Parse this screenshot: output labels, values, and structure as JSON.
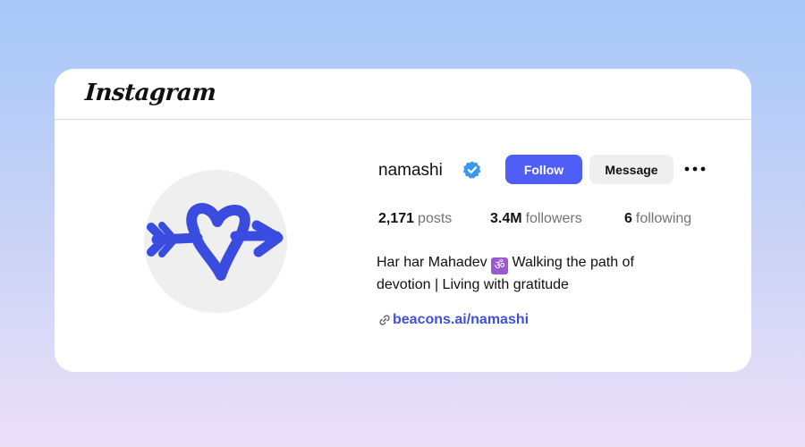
{
  "header": {
    "logo_text": "Instagram"
  },
  "profile": {
    "username": "namashi",
    "verified": true,
    "follow_label": "Follow",
    "message_label": "Message",
    "stats": {
      "posts_count": "2,171",
      "posts_label": "posts",
      "followers_count": "3.4M",
      "followers_label": "followers",
      "following_count": "6",
      "following_label": "following"
    },
    "bio": {
      "line1_before": "Har har Mahadev ",
      "om_symbol": "ॐ",
      "line1_after": " Walking the path of",
      "line2": "devotion | Living with gratitude"
    },
    "link": "beacons.ai/namashi"
  },
  "icons": {
    "verified": "verified-badge-icon",
    "more": "more-options-icon",
    "link": "link-icon",
    "avatar": "heart-arrow-logo"
  },
  "colors": {
    "follow_button": "#4f5ef7",
    "link": "#3f51d8",
    "avatar_mark": "#3a4be0",
    "verified": "#3897f0"
  }
}
